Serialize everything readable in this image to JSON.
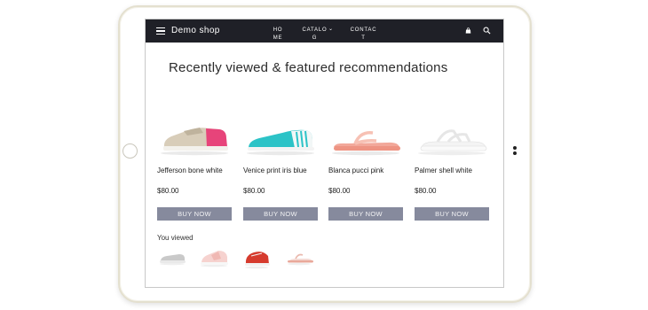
{
  "nav": {
    "brand": "Demo shop",
    "home": "HOME",
    "catalog": "CATALOG",
    "contact": "CONTACT"
  },
  "page_title": "Recently viewed & featured recommendations",
  "products": [
    {
      "name": "Jefferson bone white",
      "price": "$80.00",
      "buy_label": "BUY NOW"
    },
    {
      "name": "Venice print iris blue",
      "price": "$80.00",
      "buy_label": "BUY NOW"
    },
    {
      "name": "Blanca pucci pink",
      "price": "$80.00",
      "buy_label": "BUY NOW"
    },
    {
      "name": "Palmer shell white",
      "price": "$80.00",
      "buy_label": "BUY NOW"
    }
  ],
  "you_viewed_label": "You viewed",
  "icons": {
    "menu": "menu-icon",
    "bag": "shopping-bag-icon",
    "search": "search-icon",
    "chevron": "chevron-down-icon"
  },
  "colors": {
    "nav_bg": "#1f2027",
    "button_bg": "#868a9d",
    "button_text": "#f2f2f4"
  }
}
